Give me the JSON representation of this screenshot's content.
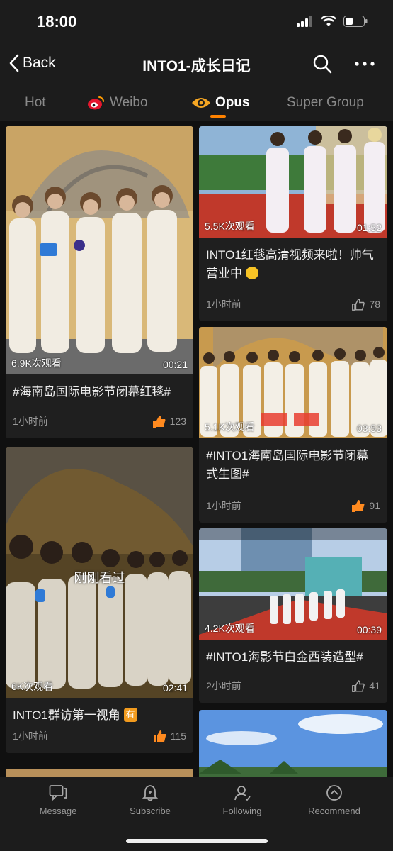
{
  "status": {
    "time": "18:00"
  },
  "nav": {
    "back_label": "Back",
    "title": "INTO1-成长日记"
  },
  "tabs": [
    {
      "label": "Hot",
      "active": false
    },
    {
      "label": "Weibo",
      "active": false,
      "icon": "weibo-icon"
    },
    {
      "label": "Opus",
      "active": true,
      "icon": "opus-eye-icon"
    },
    {
      "label": "Super Group",
      "active": false
    }
  ],
  "colors": {
    "accent": "#ff8200",
    "background": "#101010",
    "card": "#1f1f1f"
  },
  "cards": [
    {
      "views": "6.9K次观看",
      "duration": "00:21",
      "title": "#海南岛国际电影节闭幕红毯#",
      "time": "1小时前",
      "likes": "123",
      "liked_hot": true
    },
    {
      "views": "5.5K次观看",
      "duration": "01:52",
      "title": "INTO1红毯高清视频来啦！帅气营业中",
      "time": "1小时前",
      "likes": "78",
      "liked_hot": false
    },
    {
      "views": "5.1K次观看",
      "duration": "03:53",
      "title": "#INTO1海南岛国际电影节闭幕式生图#",
      "time": "1小时前",
      "likes": "91",
      "liked_hot": true
    },
    {
      "views": "6K次观看",
      "duration": "02:41",
      "watched": "刚刚看过",
      "title": "INTO1群访第一视角",
      "badge": "有",
      "time": "1小时前",
      "likes": "115",
      "liked_hot": true
    },
    {
      "views": "4.2K次观看",
      "duration": "00:39",
      "title": "#INTO1海影节白金西装造型#",
      "time": "2小时前",
      "likes": "41",
      "liked_hot": false
    }
  ],
  "bottom_nav": [
    {
      "label": "Message",
      "icon": "message-icon"
    },
    {
      "label": "Subscribe",
      "icon": "bell-icon"
    },
    {
      "label": "Following",
      "icon": "person-icon"
    },
    {
      "label": "Recommend",
      "icon": "compass-icon"
    }
  ]
}
